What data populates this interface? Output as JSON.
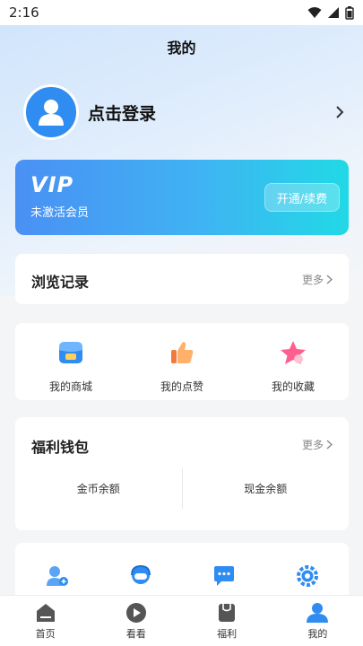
{
  "status_bar": {
    "time": "2:16"
  },
  "header": {
    "title": "我的"
  },
  "profile": {
    "login_label": "点击登录"
  },
  "vip": {
    "logo": "VIP",
    "status": "未激活会员",
    "button_label": "开通/续费"
  },
  "history": {
    "title": "浏览记录",
    "more_label": "更多"
  },
  "shortcuts": {
    "items": [
      {
        "label": "我的商城",
        "icon": "shop-icon"
      },
      {
        "label": "我的点赞",
        "icon": "thumbs-up-icon"
      },
      {
        "label": "我的收藏",
        "icon": "star-icon"
      }
    ]
  },
  "wallet": {
    "title": "福利钱包",
    "more_label": "更多",
    "coin_label": "金币余额",
    "cash_label": "现金余额"
  },
  "tools": {
    "items": [
      {
        "icon": "add-user-icon"
      },
      {
        "icon": "customer-service-icon"
      },
      {
        "icon": "message-icon"
      },
      {
        "icon": "settings-icon"
      }
    ]
  },
  "tab_bar": {
    "items": [
      {
        "label": "首页",
        "icon": "home-icon"
      },
      {
        "label": "看看",
        "icon": "play-icon"
      },
      {
        "label": "福利",
        "icon": "gift-icon"
      },
      {
        "label": "我的",
        "icon": "profile-icon",
        "active": true
      }
    ]
  },
  "colors": {
    "accent": "#2f8cf0",
    "vip_start": "#4a90f4",
    "vip_end": "#21d9e6"
  }
}
